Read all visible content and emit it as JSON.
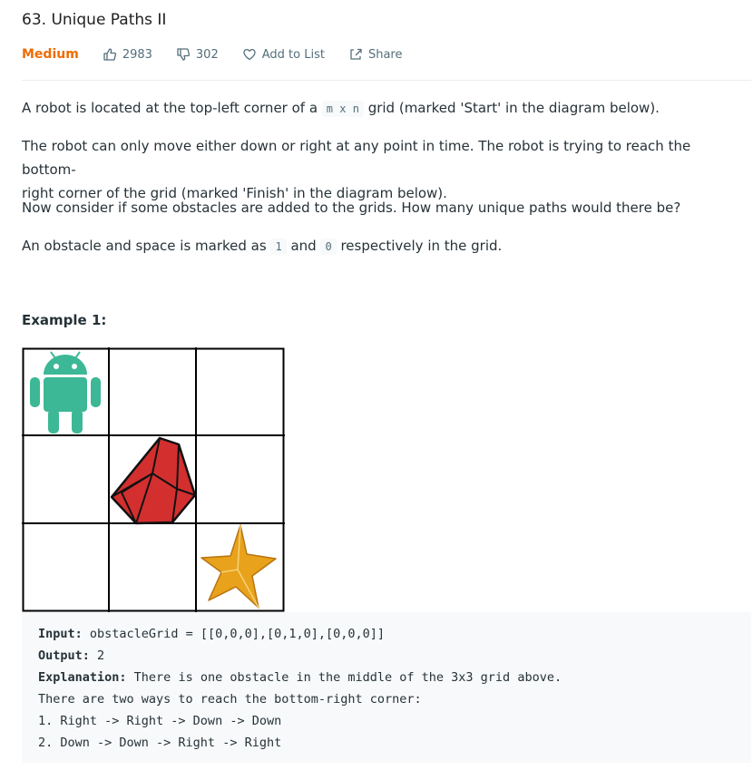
{
  "problem": {
    "title": "63. Unique Paths II",
    "difficulty": "Medium",
    "likes": "2983",
    "dislikes": "302",
    "add_to_list": "Add to List",
    "share": "Share"
  },
  "description": {
    "p1_before": "A robot is located at the top-left corner of a ",
    "p1_code": "m x n",
    "p1_after": " grid (marked 'Start' in the diagram below).",
    "p2_line1": "The robot can only move either down or right at any point in time. The robot is trying to reach the bottom-",
    "p2_line2": "right corner of the grid (marked 'Finish' in the diagram below).",
    "p3": "Now consider if some obstacles are added to the grids. How many unique paths would there be?",
    "p4_before": "An obstacle and space is marked as ",
    "p4_code1": "1",
    "p4_mid": " and ",
    "p4_code2": "0",
    "p4_after": " respectively in the grid."
  },
  "example": {
    "title": "Example 1:",
    "input_label": "Input:",
    "input_value": " obstacleGrid = [[0,0,0],[0,1,0],[0,0,0]]",
    "output_label": "Output:",
    "output_value": " 2",
    "explanation_label": "Explanation:",
    "explanation_value": " There is one obstacle in the middle of the 3x3 grid above.",
    "line4": "There are two ways to reach the bottom-right corner:",
    "line5": "1. Right -> Right -> Down -> Down",
    "line6": "2. Down -> Down -> Right -> Right"
  },
  "colors": {
    "difficulty": "#ef6c00",
    "robot": "#3db896",
    "obstacle": "#d32f2f",
    "star": "#e8a21b"
  },
  "icons": [
    "thumbs-up-icon",
    "thumbs-down-icon",
    "heart-icon",
    "share-icon",
    "robot-icon",
    "obstacle-gem-icon",
    "star-icon"
  ]
}
